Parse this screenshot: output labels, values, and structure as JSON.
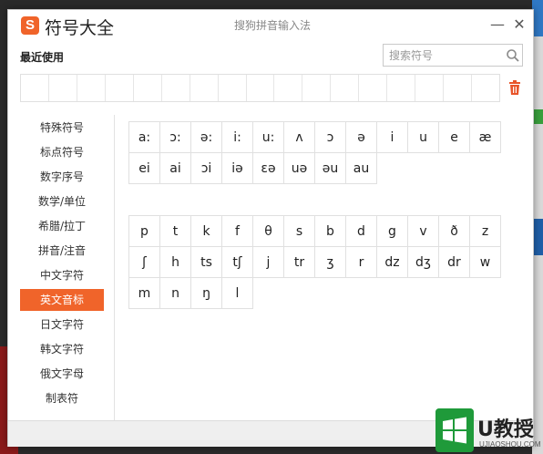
{
  "window": {
    "app_title": "符号大全",
    "title": "搜狗拼音输入法",
    "logo_text": "S",
    "minimize_label": "—",
    "close_label": "✕"
  },
  "recent": {
    "label": "最近使用",
    "slots": 17
  },
  "search": {
    "placeholder": "搜索符号",
    "icon": "search-icon"
  },
  "sidebar": {
    "items": [
      {
        "label": "特殊符号"
      },
      {
        "label": "标点符号"
      },
      {
        "label": "数字序号"
      },
      {
        "label": "数学/单位"
      },
      {
        "label": "希腊/拉丁"
      },
      {
        "label": "拼音/注音"
      },
      {
        "label": "中文字符"
      },
      {
        "label": "英文音标",
        "active": true
      },
      {
        "label": "日文字符"
      },
      {
        "label": "韩文字符"
      },
      {
        "label": "俄文字母"
      },
      {
        "label": "制表符"
      }
    ]
  },
  "vowels": [
    "a:",
    "ɔ:",
    "ə:",
    "i:",
    "u:",
    "ʌ",
    "ɔ",
    "ə",
    "i",
    "u",
    "e",
    "æ",
    "ei",
    "ai",
    "ɔi",
    "iə",
    "ɛə",
    "uə",
    "əu",
    "au"
  ],
  "consonants": [
    "p",
    "t",
    "k",
    "f",
    "θ",
    "s",
    "b",
    "d",
    "g",
    "v",
    "ð",
    "z",
    "ʃ",
    "h",
    "ts",
    "tʃ",
    "j",
    "tr",
    "ʒ",
    "r",
    "dz",
    "dʒ",
    "dr",
    "w",
    "m",
    "n",
    "ŋ",
    "l"
  ],
  "watermark": {
    "text": "U教授",
    "sub": "UJIAOSHOU.COM"
  },
  "colors": {
    "accent": "#f0642a",
    "trash": "#e8542a"
  }
}
